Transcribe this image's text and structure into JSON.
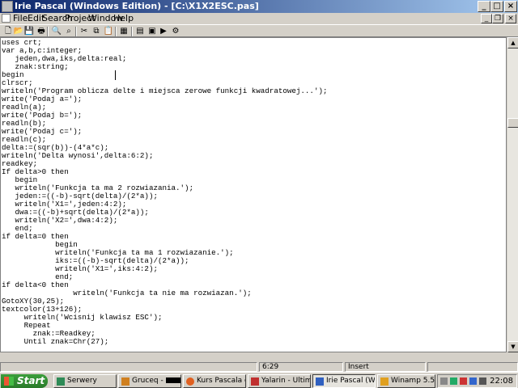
{
  "window": {
    "title": "Irie Pascal (Windows Edition) - [C:\\X1X2ESC.pas]"
  },
  "menu": {
    "items": [
      "File",
      "Edit",
      "Search",
      "Project",
      "Window",
      "Help"
    ]
  },
  "editor": {
    "lines": [
      "uses crt;",
      "var a,b,c:integer;",
      "   jeden,dwa,iks,delta:real;",
      "   znak:string;",
      "begin",
      "clrscr;",
      "writeln('Program oblicza delte i miejsca zerowe funkcji kwadratowej...');",
      "write('Podaj a=');",
      "readln(a);",
      "write('Podaj b=');",
      "readln(b);",
      "write('Podaj c=');",
      "readln(c);",
      "delta:=(sqr(b))-(4*a*c);",
      "writeln('Delta wynosi',delta:6:2);",
      "readkey;",
      "If delta>0 then",
      "   begin",
      "   writeln('Funkcja ta ma 2 rozwiazania.');",
      "   jeden:=((-b)-sqrt(delta)/(2*a));",
      "   writeln('X1=',jeden:4:2);",
      "   dwa:=((-b)+sqrt(delta)/(2*a));",
      "   writeln('X2=',dwa:4:2);",
      "   end;",
      "if delta=0 then",
      "            begin",
      "            writeln('Funkcja ta ma 1 rozwiazanie.');",
      "            iks:=((-b)-sqrt(delta)/(2*a));",
      "            writeln('X1=',iks:4:2);",
      "            end;",
      "if delta<0 then",
      "                writeln('Funkcja ta nie ma rozwiazan.');",
      "GotoXY(30,25);",
      "textcolor(13+126);",
      "     writeln('Wcisnij klawisz ESC');",
      "     Repeat",
      "       znak:=Readkey;",
      "     Until znak=Chr(27);"
    ]
  },
  "status": {
    "position": "6:29",
    "mode": "Insert"
  },
  "taskbar": {
    "start_label": "Start",
    "tasks": [
      {
        "label": "Serwery",
        "color": "#2e8b57"
      },
      {
        "label": "Gruceq - ",
        "color": "#d08020"
      },
      {
        "label": "Kurs Pascala d...",
        "color": "#e06020"
      },
      {
        "label": "Yalarin - Ultim...",
        "color": "#c03030"
      },
      {
        "label": "Irie Pascal (Wi...",
        "color": "#3060c0"
      },
      {
        "label": "Winamp 5.5",
        "color": "#e0a020"
      }
    ],
    "clock": "22:08"
  },
  "colors": {
    "title_start": "#0a246a",
    "title_end": "#a6caf0",
    "start_green": "#3c9e3c"
  }
}
